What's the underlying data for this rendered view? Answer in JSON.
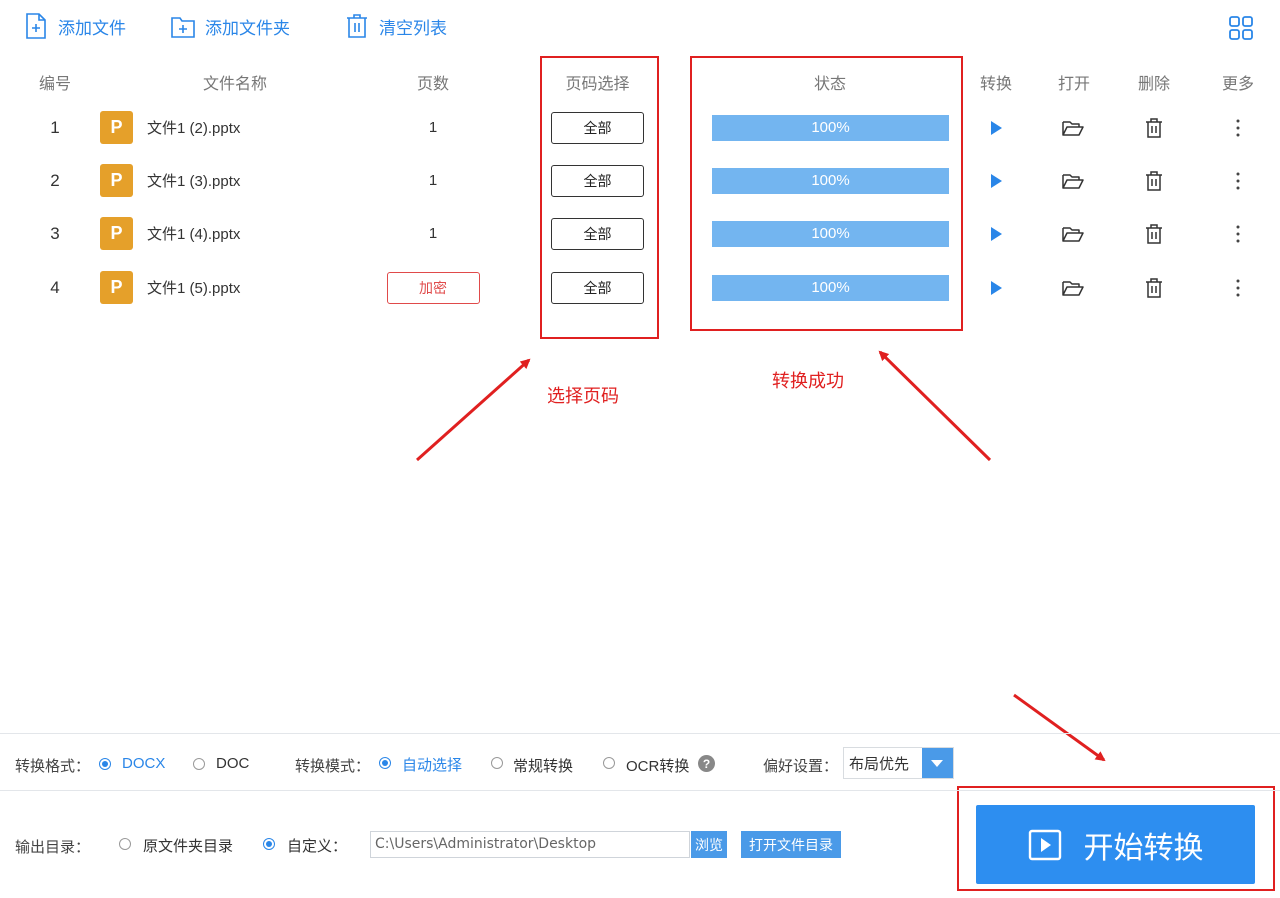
{
  "toolbar": {
    "add_file": "添加文件",
    "add_folder": "添加文件夹",
    "clear_list": "清空列表"
  },
  "table": {
    "headers": {
      "number": "编号",
      "file_name": "文件名称",
      "pages": "页数",
      "page_select": "页码选择",
      "status": "状态",
      "convert": "转换",
      "open": "打开",
      "delete": "删除",
      "more": "更多"
    },
    "rows": [
      {
        "num": "1",
        "name": "文件1 (2).pptx",
        "pages": "1",
        "page_select": "全部",
        "status": "100%"
      },
      {
        "num": "2",
        "name": "文件1 (3).pptx",
        "pages": "1",
        "page_select": "全部",
        "status": "100%"
      },
      {
        "num": "3",
        "name": "文件1 (4).pptx",
        "pages": "1",
        "page_select": "全部",
        "status": "100%"
      },
      {
        "num": "4",
        "name": "文件1 (5).pptx",
        "pages": "加密",
        "page_select": "全部",
        "status": "100%"
      }
    ],
    "file_icon_letter": "P"
  },
  "annotations": {
    "select_pages": "选择页码",
    "convert_success": "转换成功",
    "color": "#e02020"
  },
  "options": {
    "format_label": "转换格式：",
    "format_docx": "DOCX",
    "format_doc": "DOC",
    "mode_label": "转换模式：",
    "mode_auto": "自动选择",
    "mode_normal": "常规转换",
    "mode_ocr": "OCR转换",
    "help_glyph": "?",
    "pref_label": "偏好设置：",
    "pref_value": "布局优先"
  },
  "output": {
    "label": "输出目录：",
    "original_dir": "原文件夹目录",
    "custom": "自定义：",
    "path": "C:\\Users\\Administrator\\Desktop",
    "browse": "浏览",
    "open_dir": "打开文件目录"
  },
  "start_button": "开始转换",
  "colors": {
    "accent": "#2a86e8",
    "progress": "#73b5f0",
    "file_icon": "#e5a02a",
    "encrypted": "#e04a4a"
  }
}
